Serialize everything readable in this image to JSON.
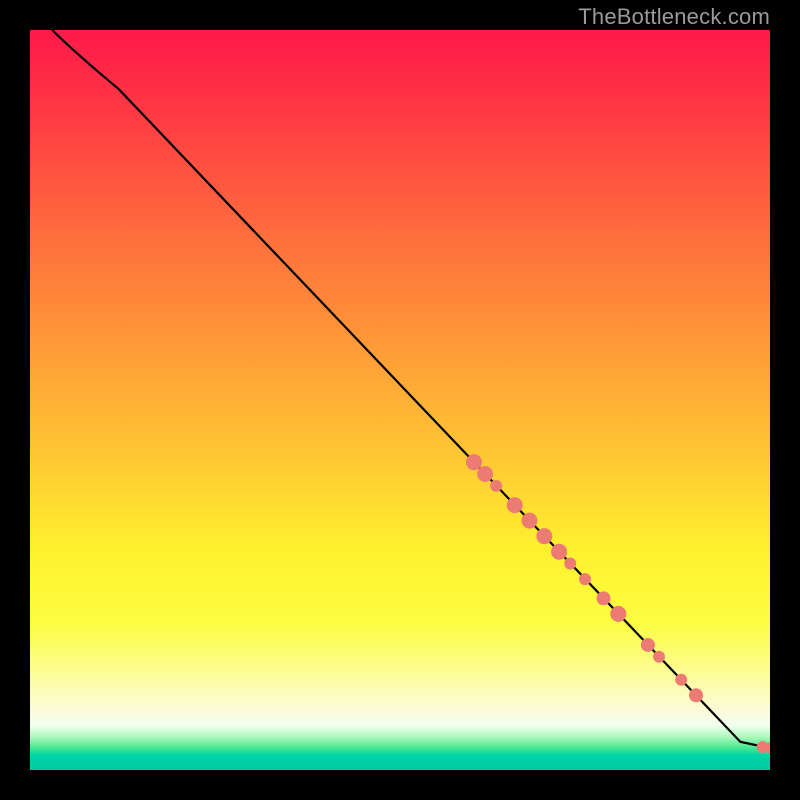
{
  "watermark": "TheBottleneck.com",
  "chart_data": {
    "type": "line",
    "title": "",
    "xlabel": "",
    "ylabel": "",
    "xlim": [
      0,
      100
    ],
    "ylim": [
      0,
      100
    ],
    "curve": {
      "name": "bottleneck-curve",
      "points": [
        {
          "x": 3,
          "y": 100
        },
        {
          "x": 6,
          "y": 97
        },
        {
          "x": 12,
          "y": 92
        },
        {
          "x": 20,
          "y": 83.6
        },
        {
          "x": 30,
          "y": 73.1
        },
        {
          "x": 40,
          "y": 62.6
        },
        {
          "x": 50,
          "y": 52.1
        },
        {
          "x": 60,
          "y": 41.6
        },
        {
          "x": 70,
          "y": 31.1
        },
        {
          "x": 80,
          "y": 20.6
        },
        {
          "x": 90,
          "y": 10.1
        },
        {
          "x": 94,
          "y": 5.9
        },
        {
          "x": 96,
          "y": 3.8
        },
        {
          "x": 99.8,
          "y": 3.0
        },
        {
          "x": 100.2,
          "y": 3.0
        }
      ]
    },
    "markers": {
      "name": "highlighted-points",
      "color": "#ec7c73",
      "points": [
        {
          "x": 60,
          "y": 41.6,
          "r": 8
        },
        {
          "x": 61.5,
          "y": 40.0,
          "r": 8
        },
        {
          "x": 63,
          "y": 38.4,
          "r": 6
        },
        {
          "x": 65.5,
          "y": 35.8,
          "r": 8
        },
        {
          "x": 67.5,
          "y": 33.7,
          "r": 8
        },
        {
          "x": 69.5,
          "y": 31.6,
          "r": 8
        },
        {
          "x": 71.5,
          "y": 29.5,
          "r": 8
        },
        {
          "x": 73,
          "y": 27.9,
          "r": 6
        },
        {
          "x": 75,
          "y": 25.8,
          "r": 6
        },
        {
          "x": 77.5,
          "y": 23.2,
          "r": 7
        },
        {
          "x": 79.5,
          "y": 21.1,
          "r": 8
        },
        {
          "x": 83.5,
          "y": 16.9,
          "r": 7
        },
        {
          "x": 85,
          "y": 15.3,
          "r": 6
        },
        {
          "x": 88,
          "y": 12.2,
          "r": 6
        },
        {
          "x": 90,
          "y": 10.1,
          "r": 7
        },
        {
          "x": 99,
          "y": 3.1,
          "r": 6
        },
        {
          "x": 100.2,
          "y": 3.0,
          "r": 6
        }
      ]
    }
  }
}
